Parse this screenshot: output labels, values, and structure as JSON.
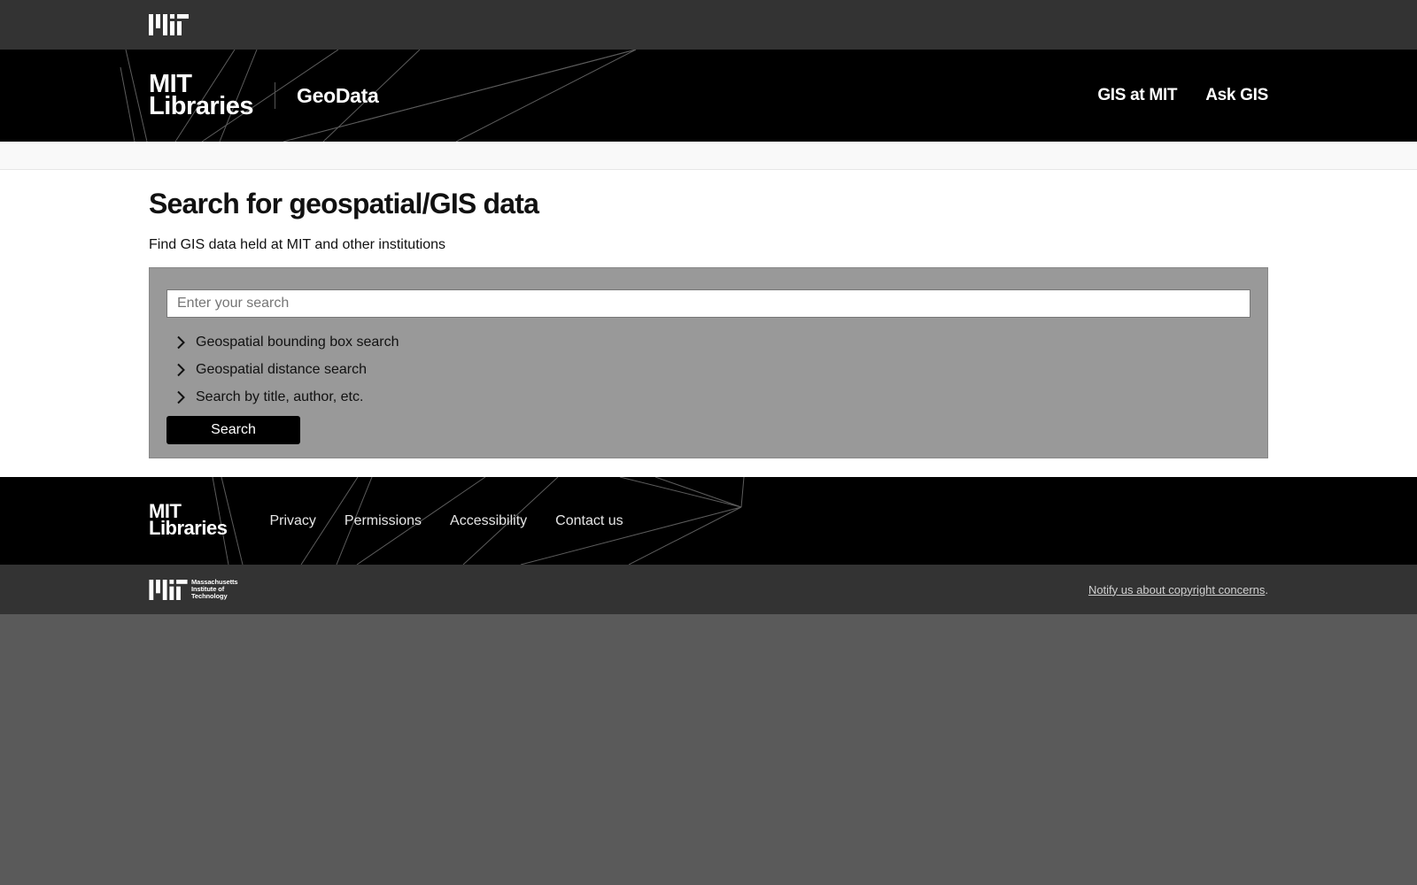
{
  "mit_bar": {
    "logo_icon": "mit-logo-icon"
  },
  "header": {
    "logo_line1": "MIT",
    "logo_line2": "Libraries",
    "site_title": "GeoData",
    "nav": [
      {
        "label": "GIS at MIT"
      },
      {
        "label": "Ask GIS"
      }
    ]
  },
  "main": {
    "title": "Search for geospatial/GIS data",
    "description": "Find GIS data held at MIT and other institutions",
    "search": {
      "placeholder": "Enter your search",
      "value": "",
      "toggles": [
        {
          "label": "Geospatial bounding box search",
          "icon": "chevron-right-icon",
          "expanded": false
        },
        {
          "label": "Geospatial distance search",
          "icon": "chevron-right-icon",
          "expanded": false
        },
        {
          "label": "Search by title, author, etc.",
          "icon": "chevron-right-icon",
          "expanded": false
        }
      ],
      "button_label": "Search"
    }
  },
  "footer": {
    "logo_line1": "MIT",
    "logo_line2": "Libraries",
    "links": [
      {
        "label": "Privacy"
      },
      {
        "label": "Permissions"
      },
      {
        "label": "Accessibility"
      },
      {
        "label": "Contact us"
      }
    ]
  },
  "institute_bar": {
    "logo_text_line1": "Massachusetts",
    "logo_text_line2": "Institute of",
    "logo_text_line3": "Technology",
    "copyright_link": "Notify us about copyright concerns",
    "copyright_suffix": "."
  },
  "colors": {
    "top_bar": "#333333",
    "header": "#000000",
    "search_panel": "#999999",
    "page_background": "#5a5a5a"
  }
}
